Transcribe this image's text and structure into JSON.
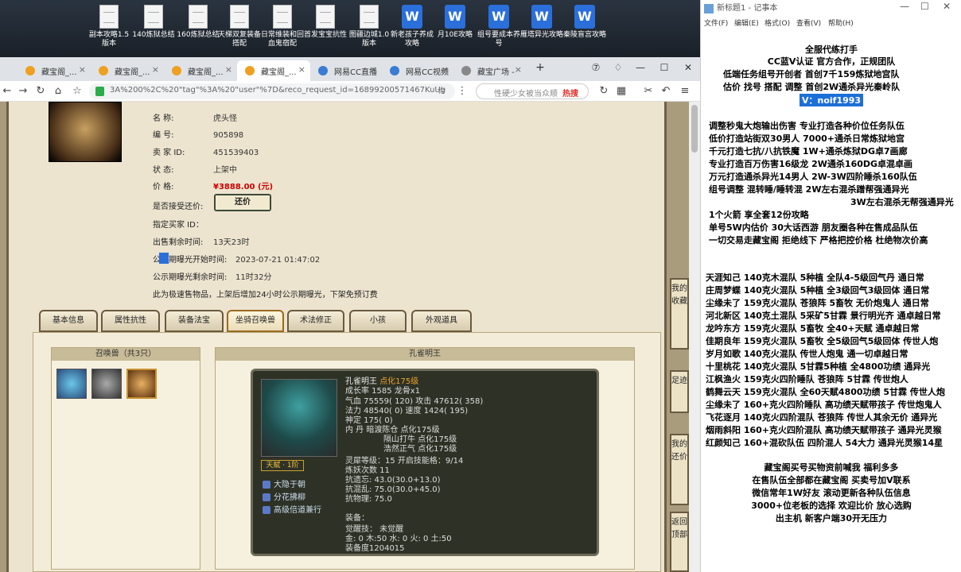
{
  "desktop": {
    "icons": [
      {
        "label": "副本攻略1.5版本",
        "type": "doc"
      },
      {
        "label": "140炼狱总结",
        "type": "doc"
      },
      {
        "label": "160炼狱总结",
        "type": "doc"
      },
      {
        "label": "天梯双复装备搭配",
        "type": "doc"
      },
      {
        "label": "日常维装和回血鬼宿配",
        "type": "doc"
      },
      {
        "label": "首发宝宝抗性",
        "type": "doc"
      },
      {
        "label": "图疆边城1.0版本",
        "type": "doc"
      },
      {
        "label": "新老孩子养成攻略",
        "type": "word"
      },
      {
        "label": "月10E攻略",
        "type": "word"
      },
      {
        "label": "组号要成本养号",
        "type": "word"
      },
      {
        "label": "雁塔异光攻略",
        "type": "word"
      },
      {
        "label": "秦陵盲宫攻略",
        "type": "word"
      }
    ]
  },
  "browser": {
    "tabs": [
      {
        "label": "藏宝阁_...",
        "active": false
      },
      {
        "label": "藏宝阁_...",
        "active": false
      },
      {
        "label": "藏宝阁_...",
        "active": false
      },
      {
        "label": "藏宝阁_...",
        "active": true
      },
      {
        "label": "网易CC直播",
        "active": false
      },
      {
        "label": "网易CC视频",
        "active": false
      },
      {
        "label": "藏宝广场 -",
        "active": false
      }
    ],
    "new_tab": "+",
    "url": "3A%200%2C%20\"tag\"%3A%20\"user\"%7D&reco_request_id=16899200571467KuUg",
    "search_placeholder": "性硬少女被当众顺",
    "search_hot": "热搜"
  },
  "item": {
    "name_label": "名        称:",
    "name": "虎头怪",
    "id_label": "编        号:",
    "id": "905898",
    "seller_label": "卖  家  ID:",
    "seller_id": "451539403",
    "status_label": "状        态:",
    "status": "上架中",
    "price_label": "价        格:",
    "price": "¥3888.00 (元)",
    "bargain_label": "是否接受还价:",
    "bargain_btn": "还价",
    "buyer_label": "指定买家 ID：",
    "remain_label": "出售剩余时间:",
    "remain": "13天23时",
    "pub_start_label": "公示期曝光开始时间:",
    "pub_start": "2023-07-21 01:47:02",
    "pub_left_label": "公示期曝光剩余时间:",
    "pub_left": "11时32分",
    "note": "此为极速售物品，上架后增加24小时公示期曝光，下架免预订费"
  },
  "section_tabs": [
    "基本信息",
    "属性抗性",
    "装备法宝",
    "坐骑召唤兽",
    "术法修正",
    "小孩",
    "外观道具"
  ],
  "pets": {
    "header": "召唤兽（共3只）",
    "detail_title": "孔雀明王",
    "name": "孔雀明王",
    "name_tag": "点化175级",
    "growth": "成长率 1585 龙骨x1",
    "hp": "气血 75559( 120) 攻击 47612( 358)",
    "mp": "法力 48540( 0) 速度 1424( 195)",
    "shen": "神定 175( 0)",
    "dan1": "内    丹 暗渡陈仓 点化175级",
    "dan2": "隔山打牛 点化175级",
    "dan3": "浩然正气 点化175级",
    "spirit": "灵犀等级：15 开启技能格：9/14",
    "refine": "炼妖次数 11",
    "res1": "抗遗忘: 43.0(30.0+13.0)",
    "res2": "抗混乱: 75.0(30.0+45.0)",
    "res3": "抗物理: 75.0",
    "tier": "天赋 · 1阶",
    "skills": [
      "大隐于朝",
      "分花拂柳",
      "高级倍道兼行"
    ],
    "equip_label": "装备：",
    "awaken": "觉醒技：  未觉醒",
    "elements": "金: 0 木:50 水: 0 火: 0 土:50",
    "attire": "装备度1204015"
  },
  "side_buttons": [
    "我的收藏",
    "足迹",
    "我的还价",
    "返回顶部"
  ],
  "notepad": {
    "title": "新标题1 - 记事本",
    "menu": [
      "文件(F)",
      "编辑(E)",
      "格式(O)",
      "查看(V)",
      "帮助(H)"
    ],
    "lines": [
      "全服代练打手",
      "CC蓝V认证 官方合作，正规团队",
      "低端任务组号开创者          首创7千159炼狱地宫队",
      "估价 找号 搭配 调整           首创2W通杀异光秦岭队",
      "V：noif1993",
      "调整秒鬼大炮输出伤害          专业打造各种价位任务队伍",
      "低价打造站街双30男人            7000+通杀日常炼狱地宫",
      "千元打造七抗/八抗铁魔           1W+通杀炼狱DG卓7画廊",
      "专业打造百万伤害16级龙          2W通杀160DG卓混卓画",
      "万元打造通杀异光14男人        2W-3W四阶睡杀160队伍",
      "组号调整 混转睡/睡转混            2W左右混杀蹭帮强通异光",
      "3W左右混杀无帮强通异光",
      "1个火箭 享全套12份攻略",
      "单号5W内估价 30大话西游         朋友圈各种在售成品队伍",
      "一切交易走藏宝阁 拒绝线下     严格把控价格 杜绝物次价高",
      "天涯知己 140克木混队 5种植 全队4-5级回气丹 通日常",
      "庄周梦蝶 140克火混队 5种植 全3级回气3级回体 通日常",
      "尘缘未了 159克火混队 苍狼阵 5畜牧 无价炮鬼人 通日常",
      "河北新区 140克土混队 5采矿5甘霖 景行明光齐 通卓越日常",
      "龙吟东方 159克火混队 5畜牧 全40+天赋 通卓越日常",
      "佳期良年 159克火混队 5畜牧 全5级回气5级回体 传世人炮",
      "岁月如歌 140克火混队 传世人炮鬼 通一切卓越日常",
      "十里桃花 140克火混队 5甘霖5种植 全4800功绩 通异光",
      "江枫渔火 159克火四阶睡队 苍狼阵 5甘霖 传世炮人",
      "鹤舞云天 159克火混队 全60天赋4800功绩 5甘霖 传世人炮",
      "尘缘未了 160+克火四阶睡队 高功绩天赋带孩子 传世炮鬼人",
      "飞花逐月 140克火四阶混队 苍狼阵 传世人其余无价 通异光",
      "烟雨斜阳 160+克火四阶混队 高功绩天赋带孩子 通异光灵猴",
      "红颜知己 160+混砍队伍 四阶混人 54大力 通异光灵猴14星",
      "藏宝阁买号买物资前喊我 福利多多",
      "在售队伍全部都在藏宝阁 买卖号加V联系",
      "微信常年1W好友 滚动更新各种队伍信息",
      "3000+位老板的选择 欢迎比价 放心选购",
      "出主机 新客户端30开无压力"
    ]
  },
  "colors": {
    "price": "#cc0000",
    "selection": "#1d6fd8",
    "panel": "#ede4cf"
  }
}
